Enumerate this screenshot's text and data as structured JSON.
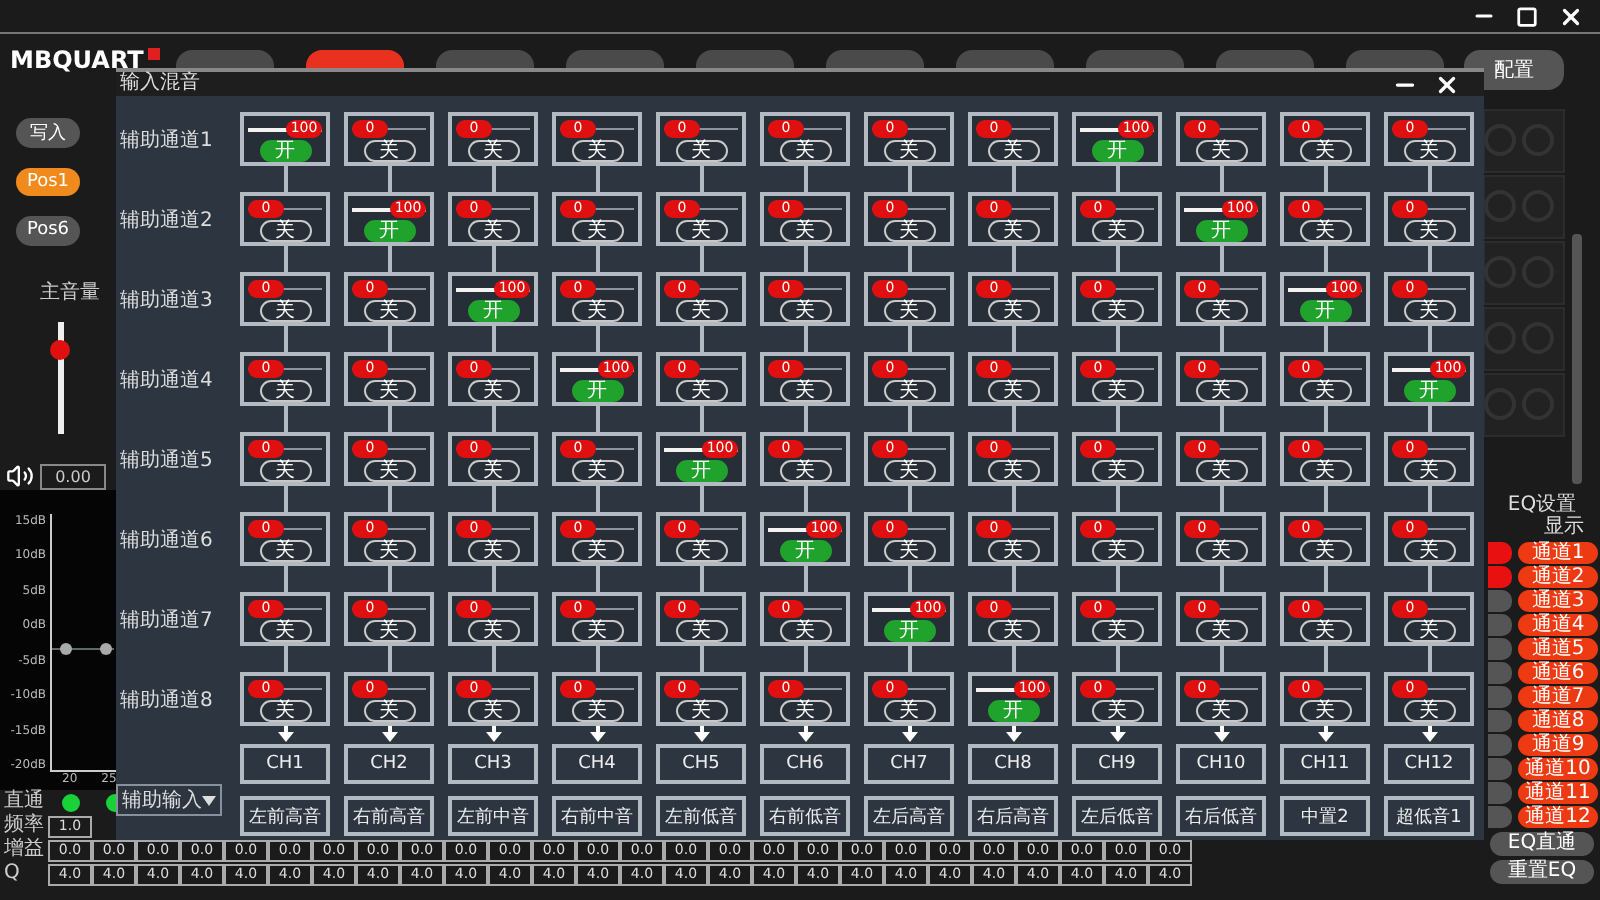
{
  "header": {
    "logo": "MBQUART",
    "tabs": [
      {
        "selected": false
      },
      {
        "selected": true
      },
      {
        "selected": false
      },
      {
        "selected": false
      },
      {
        "selected": false
      },
      {
        "selected": false
      },
      {
        "selected": false
      },
      {
        "selected": false
      },
      {
        "selected": false
      },
      {
        "selected": false
      }
    ],
    "config_button": "配置"
  },
  "left_panel": {
    "write_button": "写入",
    "presets": [
      {
        "label": "Pos1",
        "selected": true
      },
      {
        "label": "Pos6",
        "selected": false
      }
    ],
    "master_volume": {
      "label": "主音量",
      "level": 0.8,
      "value": "0.00"
    }
  },
  "eq_graph": {
    "y_labels": [
      "15dB",
      "10dB",
      "5dB",
      "0dB",
      "-5dB",
      "-10dB",
      "-15dB",
      "-20dB"
    ],
    "x_labels": [
      "20",
      "25"
    ]
  },
  "eq_table": {
    "labels": [
      "直通",
      "频率",
      "增益",
      "Q"
    ],
    "bypass": [
      {
        "on": true
      },
      {
        "on": true
      }
    ],
    "frequency": [
      "1.0"
    ],
    "gain": [
      "0.0",
      "0.0",
      "0.0",
      "0.0",
      "0.0",
      "0.0",
      "0.0",
      "0.0",
      "0.0",
      "0.0",
      "0.0",
      "0.0",
      "0.0",
      "0.0",
      "0.0",
      "0.0",
      "0.0",
      "0.0",
      "0.0",
      "0.0",
      "0.0",
      "0.0",
      "0.0",
      "0.0",
      "0.0",
      "0.0"
    ],
    "q": [
      "4.0",
      "4.0",
      "4.0",
      "4.0",
      "4.0",
      "4.0",
      "4.0",
      "4.0",
      "4.0",
      "4.0",
      "4.0",
      "4.0",
      "4.0",
      "4.0",
      "4.0",
      "4.0",
      "4.0",
      "4.0",
      "4.0",
      "4.0",
      "4.0",
      "4.0",
      "4.0",
      "4.0",
      "4.0",
      "4.0"
    ]
  },
  "right_panel": {
    "eq_title": "EQ设置",
    "display_label": "显示",
    "eq_toggles": [
      {
        "on": true
      },
      {
        "on": true
      },
      {
        "on": false
      },
      {
        "on": false
      },
      {
        "on": false
      },
      {
        "on": false
      },
      {
        "on": false
      },
      {
        "on": false
      },
      {
        "on": false
      },
      {
        "on": false
      },
      {
        "on": false
      },
      {
        "on": false
      }
    ],
    "channels": [
      {
        "label": "通道1",
        "active": true
      },
      {
        "label": "通道2",
        "active": true
      },
      {
        "label": "通道3",
        "active": true
      },
      {
        "label": "通道4",
        "active": true
      },
      {
        "label": "通道5",
        "active": true
      },
      {
        "label": "通道6",
        "active": true
      },
      {
        "label": "通道7",
        "active": true
      },
      {
        "label": "通道8",
        "active": true
      },
      {
        "label": "通道9",
        "active": true
      },
      {
        "label": "通道10",
        "active": true
      },
      {
        "label": "通道11",
        "active": true
      },
      {
        "label": "通道12",
        "active": true
      }
    ],
    "eq_bypass_button": "EQ直通",
    "reset_eq_button": "重置EQ"
  },
  "mixer": {
    "title": "输入混音",
    "rows": [
      {
        "label": "辅助通道1",
        "cells": [
          {
            "reading": "100",
            "level": 1,
            "switch": "开",
            "on": true
          },
          {
            "reading": "0",
            "level": 0,
            "switch": "关",
            "on": false
          },
          {
            "reading": "0",
            "level": 0,
            "switch": "关",
            "on": false
          },
          {
            "reading": "0",
            "level": 0,
            "switch": "关",
            "on": false
          },
          {
            "reading": "0",
            "level": 0,
            "switch": "关",
            "on": false
          },
          {
            "reading": "0",
            "level": 0,
            "switch": "关",
            "on": false
          },
          {
            "reading": "0",
            "level": 0,
            "switch": "关",
            "on": false
          },
          {
            "reading": "0",
            "level": 0,
            "switch": "关",
            "on": false
          },
          {
            "reading": "100",
            "level": 1,
            "switch": "开",
            "on": true
          },
          {
            "reading": "0",
            "level": 0,
            "switch": "关",
            "on": false
          },
          {
            "reading": "0",
            "level": 0,
            "switch": "关",
            "on": false
          },
          {
            "reading": "0",
            "level": 0,
            "switch": "关",
            "on": false
          }
        ]
      },
      {
        "label": "辅助通道2",
        "cells": [
          {
            "reading": "0",
            "level": 0,
            "switch": "关",
            "on": false
          },
          {
            "reading": "100",
            "level": 1,
            "switch": "开",
            "on": true
          },
          {
            "reading": "0",
            "level": 0,
            "switch": "关",
            "on": false
          },
          {
            "reading": "0",
            "level": 0,
            "switch": "关",
            "on": false
          },
          {
            "reading": "0",
            "level": 0,
            "switch": "关",
            "on": false
          },
          {
            "reading": "0",
            "level": 0,
            "switch": "关",
            "on": false
          },
          {
            "reading": "0",
            "level": 0,
            "switch": "关",
            "on": false
          },
          {
            "reading": "0",
            "level": 0,
            "switch": "关",
            "on": false
          },
          {
            "reading": "0",
            "level": 0,
            "switch": "关",
            "on": false
          },
          {
            "reading": "100",
            "level": 1,
            "switch": "开",
            "on": true
          },
          {
            "reading": "0",
            "level": 0,
            "switch": "关",
            "on": false
          },
          {
            "reading": "0",
            "level": 0,
            "switch": "关",
            "on": false
          }
        ]
      },
      {
        "label": "辅助通道3",
        "cells": [
          {
            "reading": "0",
            "level": 0,
            "switch": "关",
            "on": false
          },
          {
            "reading": "0",
            "level": 0,
            "switch": "关",
            "on": false
          },
          {
            "reading": "100",
            "level": 1,
            "switch": "开",
            "on": true
          },
          {
            "reading": "0",
            "level": 0,
            "switch": "关",
            "on": false
          },
          {
            "reading": "0",
            "level": 0,
            "switch": "关",
            "on": false
          },
          {
            "reading": "0",
            "level": 0,
            "switch": "关",
            "on": false
          },
          {
            "reading": "0",
            "level": 0,
            "switch": "关",
            "on": false
          },
          {
            "reading": "0",
            "level": 0,
            "switch": "关",
            "on": false
          },
          {
            "reading": "0",
            "level": 0,
            "switch": "关",
            "on": false
          },
          {
            "reading": "0",
            "level": 0,
            "switch": "关",
            "on": false
          },
          {
            "reading": "100",
            "level": 1,
            "switch": "开",
            "on": true
          },
          {
            "reading": "0",
            "level": 0,
            "switch": "关",
            "on": false
          }
        ]
      },
      {
        "label": "辅助通道4",
        "cells": [
          {
            "reading": "0",
            "level": 0,
            "switch": "关",
            "on": false
          },
          {
            "reading": "0",
            "level": 0,
            "switch": "关",
            "on": false
          },
          {
            "reading": "0",
            "level": 0,
            "switch": "关",
            "on": false
          },
          {
            "reading": "100",
            "level": 1,
            "switch": "开",
            "on": true
          },
          {
            "reading": "0",
            "level": 0,
            "switch": "关",
            "on": false
          },
          {
            "reading": "0",
            "level": 0,
            "switch": "关",
            "on": false
          },
          {
            "reading": "0",
            "level": 0,
            "switch": "关",
            "on": false
          },
          {
            "reading": "0",
            "level": 0,
            "switch": "关",
            "on": false
          },
          {
            "reading": "0",
            "level": 0,
            "switch": "关",
            "on": false
          },
          {
            "reading": "0",
            "level": 0,
            "switch": "关",
            "on": false
          },
          {
            "reading": "0",
            "level": 0,
            "switch": "关",
            "on": false
          },
          {
            "reading": "100",
            "level": 1,
            "switch": "开",
            "on": true
          }
        ]
      },
      {
        "label": "辅助通道5",
        "cells": [
          {
            "reading": "0",
            "level": 0,
            "switch": "关",
            "on": false
          },
          {
            "reading": "0",
            "level": 0,
            "switch": "关",
            "on": false
          },
          {
            "reading": "0",
            "level": 0,
            "switch": "关",
            "on": false
          },
          {
            "reading": "0",
            "level": 0,
            "switch": "关",
            "on": false
          },
          {
            "reading": "100",
            "level": 1,
            "switch": "开",
            "on": true
          },
          {
            "reading": "0",
            "level": 0,
            "switch": "关",
            "on": false
          },
          {
            "reading": "0",
            "level": 0,
            "switch": "关",
            "on": false
          },
          {
            "reading": "0",
            "level": 0,
            "switch": "关",
            "on": false
          },
          {
            "reading": "0",
            "level": 0,
            "switch": "关",
            "on": false
          },
          {
            "reading": "0",
            "level": 0,
            "switch": "关",
            "on": false
          },
          {
            "reading": "0",
            "level": 0,
            "switch": "关",
            "on": false
          },
          {
            "reading": "0",
            "level": 0,
            "switch": "关",
            "on": false
          }
        ]
      },
      {
        "label": "辅助通道6",
        "cells": [
          {
            "reading": "0",
            "level": 0,
            "switch": "关",
            "on": false
          },
          {
            "reading": "0",
            "level": 0,
            "switch": "关",
            "on": false
          },
          {
            "reading": "0",
            "level": 0,
            "switch": "关",
            "on": false
          },
          {
            "reading": "0",
            "level": 0,
            "switch": "关",
            "on": false
          },
          {
            "reading": "0",
            "level": 0,
            "switch": "关",
            "on": false
          },
          {
            "reading": "100",
            "level": 1,
            "switch": "开",
            "on": true
          },
          {
            "reading": "0",
            "level": 0,
            "switch": "关",
            "on": false
          },
          {
            "reading": "0",
            "level": 0,
            "switch": "关",
            "on": false
          },
          {
            "reading": "0",
            "level": 0,
            "switch": "关",
            "on": false
          },
          {
            "reading": "0",
            "level": 0,
            "switch": "关",
            "on": false
          },
          {
            "reading": "0",
            "level": 0,
            "switch": "关",
            "on": false
          },
          {
            "reading": "0",
            "level": 0,
            "switch": "关",
            "on": false
          }
        ]
      },
      {
        "label": "辅助通道7",
        "cells": [
          {
            "reading": "0",
            "level": 0,
            "switch": "关",
            "on": false
          },
          {
            "reading": "0",
            "level": 0,
            "switch": "关",
            "on": false
          },
          {
            "reading": "0",
            "level": 0,
            "switch": "关",
            "on": false
          },
          {
            "reading": "0",
            "level": 0,
            "switch": "关",
            "on": false
          },
          {
            "reading": "0",
            "level": 0,
            "switch": "关",
            "on": false
          },
          {
            "reading": "0",
            "level": 0,
            "switch": "关",
            "on": false
          },
          {
            "reading": "100",
            "level": 1,
            "switch": "开",
            "on": true
          },
          {
            "reading": "0",
            "level": 0,
            "switch": "关",
            "on": false
          },
          {
            "reading": "0",
            "level": 0,
            "switch": "关",
            "on": false
          },
          {
            "reading": "0",
            "level": 0,
            "switch": "关",
            "on": false
          },
          {
            "reading": "0",
            "level": 0,
            "switch": "关",
            "on": false
          },
          {
            "reading": "0",
            "level": 0,
            "switch": "关",
            "on": false
          }
        ]
      },
      {
        "label": "辅助通道8",
        "cells": [
          {
            "reading": "0",
            "level": 0,
            "switch": "关",
            "on": false
          },
          {
            "reading": "0",
            "level": 0,
            "switch": "关",
            "on": false
          },
          {
            "reading": "0",
            "level": 0,
            "switch": "关",
            "on": false
          },
          {
            "reading": "0",
            "level": 0,
            "switch": "关",
            "on": false
          },
          {
            "reading": "0",
            "level": 0,
            "switch": "关",
            "on": false
          },
          {
            "reading": "0",
            "level": 0,
            "switch": "关",
            "on": false
          },
          {
            "reading": "0",
            "level": 0,
            "switch": "关",
            "on": false
          },
          {
            "reading": "100",
            "level": 1,
            "switch": "开",
            "on": true
          },
          {
            "reading": "0",
            "level": 0,
            "switch": "关",
            "on": false
          },
          {
            "reading": "0",
            "level": 0,
            "switch": "关",
            "on": false
          },
          {
            "reading": "0",
            "level": 0,
            "switch": "关",
            "on": false
          },
          {
            "reading": "0",
            "level": 0,
            "switch": "关",
            "on": false
          }
        ]
      }
    ],
    "outputs": [
      "CH1",
      "CH2",
      "CH3",
      "CH4",
      "CH5",
      "CH6",
      "CH7",
      "CH8",
      "CH9",
      "CH10",
      "CH11",
      "CH12"
    ],
    "output_names": [
      "左前高音",
      "右前高音",
      "左前中音",
      "右前中音",
      "左前低音",
      "右前低音",
      "左后高音",
      "右后高音",
      "左后低音",
      "右后低音",
      "中置2",
      "超低音1"
    ],
    "source_select": "辅助输入"
  }
}
